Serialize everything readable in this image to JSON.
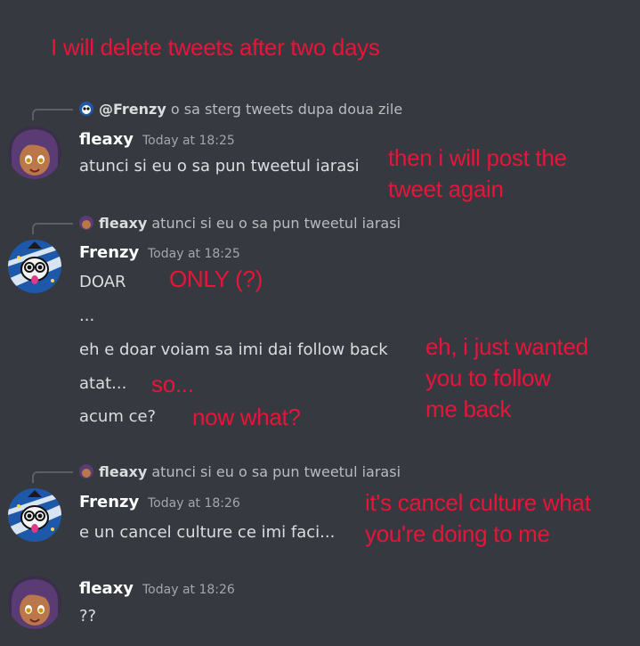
{
  "annotations": {
    "title": "I will delete tweets after two days",
    "post_again_1": "then i will post the",
    "post_again_2": "tweet again",
    "only": "ONLY (?)",
    "follow_1": "eh, i just wanted",
    "follow_2": "you to follow",
    "follow_3": "me back",
    "so": "so...",
    "now_what": "now what?",
    "cancel_1": "it's cancel culture what",
    "cancel_2": "you're doing to me"
  },
  "colors": {
    "background": "#36393f",
    "annotation_red": "#e8143a",
    "username": "#ffffff",
    "timestamp": "#a3a6aa",
    "message": "#dcddde"
  },
  "messages": [
    {
      "reply": {
        "name": "@Frenzy",
        "text": "o sa sterg tweets dupa doua zile",
        "avatar_icon": "frenzy-avatar-icon"
      },
      "author": "fleaxy",
      "time": "Today at 18:25",
      "lines": [
        "atunci si eu o sa pun tweetul iarasi"
      ]
    },
    {
      "reply": {
        "name": "fleaxy",
        "text": "atunci si eu o sa pun tweetul iarasi",
        "avatar_icon": "fleaxy-avatar-icon"
      },
      "author": "Frenzy",
      "time": "Today at 18:25",
      "lines": [
        "DOAR",
        "...",
        "eh e doar voiam sa imi dai follow back",
        "atat...",
        "acum ce?"
      ]
    },
    {
      "reply": {
        "name": "fleaxy",
        "text": "atunci si eu o sa pun tweetul iarasi",
        "avatar_icon": "fleaxy-avatar-icon"
      },
      "author": "Frenzy",
      "time": "Today at 18:26",
      "lines": [
        "e un cancel culture ce imi faci..."
      ]
    },
    {
      "author": "fleaxy",
      "time": "Today at 18:26",
      "lines": [
        "??"
      ]
    }
  ]
}
